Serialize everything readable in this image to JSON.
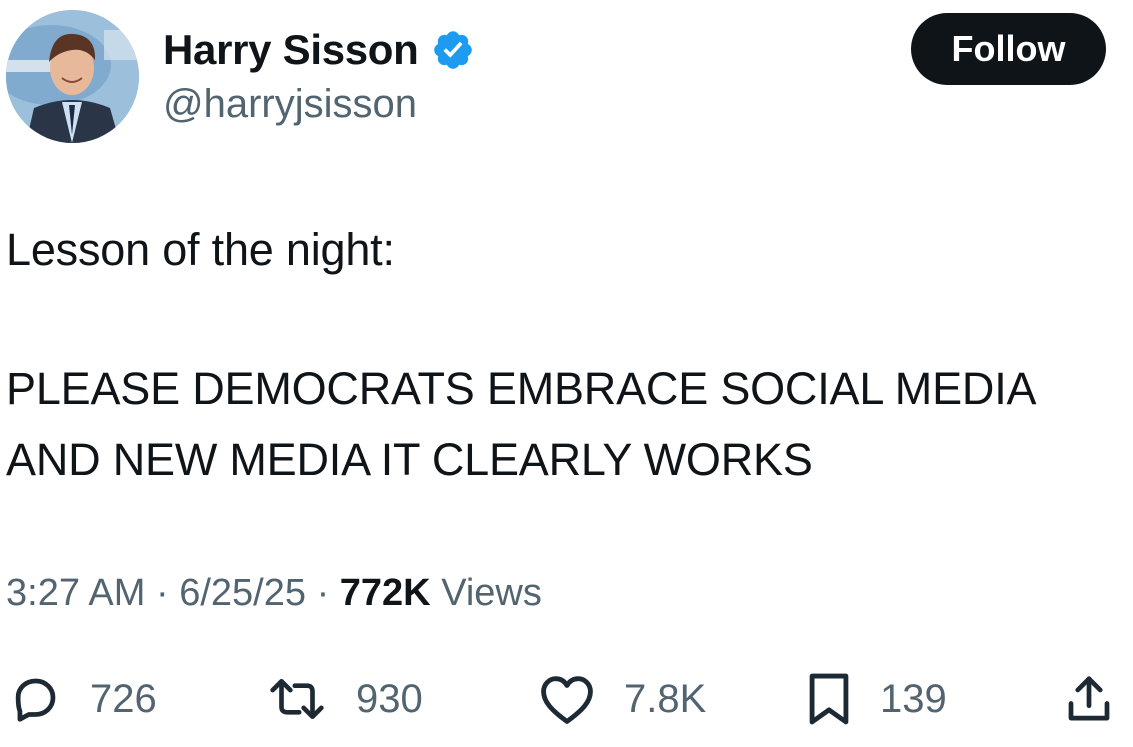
{
  "author": {
    "display_name": "Harry Sisson",
    "handle": "@harryjsisson",
    "verified": true,
    "verified_color": "#1d9bf0"
  },
  "follow_button": {
    "label": "Follow"
  },
  "tweet": {
    "lines": [
      "Lesson of the night:",
      "PLEASE DEMOCRATS EMBRACE SOCIAL MEDIA",
      "AND NEW MEDIA IT CLEARLY WORKS"
    ]
  },
  "meta": {
    "time": "3:27 AM",
    "date": "6/25/25",
    "views_count": "772K",
    "views_label": "Views"
  },
  "actions": {
    "replies": "726",
    "reposts": "930",
    "likes": "7.8K",
    "bookmarks": "139"
  },
  "icons": {
    "reply": "reply-icon",
    "repost": "repost-icon",
    "like": "heart-icon",
    "bookmark": "bookmark-icon",
    "share": "share-icon",
    "verified": "verified-badge-icon"
  },
  "colors": {
    "text": "#0f1419",
    "secondary": "#536471",
    "follow_bg": "#0f1419"
  }
}
